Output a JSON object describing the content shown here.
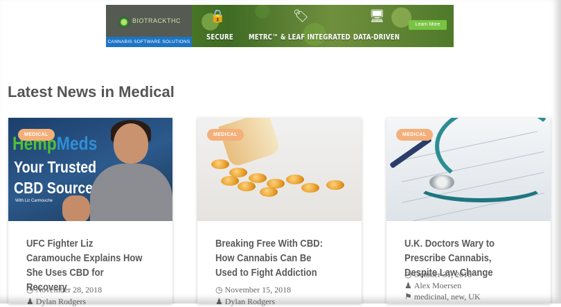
{
  "banner": {
    "brand": "BIOTRACKTHC",
    "tagline": "CANNABIS SOFTWARE SOLUTIONS",
    "features": [
      "SECURE",
      "METRC™ & LEAF INTEGRATED",
      "DATA-DRIVEN"
    ],
    "cta": "Learn More"
  },
  "section": {
    "title": "Latest News in Medical"
  },
  "cards": [
    {
      "badge": "MEDICAL",
      "image_text": {
        "line1a": "Hemp",
        "line1b": "Meds",
        "line2": "Your Trusted",
        "line3": "CBD Source",
        "line4": "With Liz Carmouche"
      },
      "title": "UFC Fighter Liz Caramouche Explains How She Uses CBD for Recovery",
      "date": "November 28, 2018",
      "author": "Dylan Rodgers"
    },
    {
      "badge": "MEDICAL",
      "title": "Breaking Free With CBD: How Cannabis Can Be Used to Fight Addiction",
      "date": "November 15, 2018",
      "author": "Dylan Rodgers"
    },
    {
      "badge": "MEDICAL",
      "title": "U.K. Doctors Wary to Prescribe Cannabis, Despite Law Change",
      "date": "October 31, 2018",
      "author": "Alex Moersen",
      "tags": "medicinal, new, UK"
    }
  ],
  "icons": {
    "date": "clock-icon",
    "author": "user-icon",
    "tags": "tag-icon"
  }
}
